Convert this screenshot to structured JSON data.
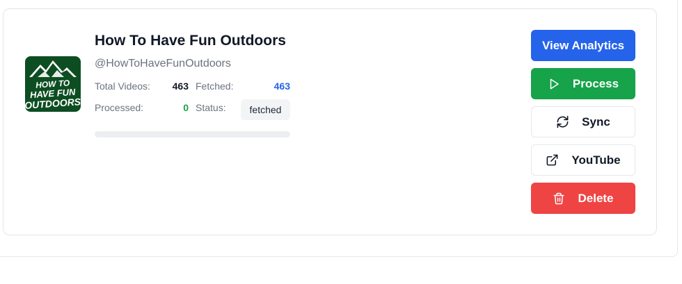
{
  "channel": {
    "title": "How To Have Fun Outdoors",
    "handle": "@HowToHaveFunOutdoors",
    "avatar_text": [
      "HOW TO",
      "HAVE FUN",
      "OUTDOORS"
    ]
  },
  "stats": {
    "total_videos_label": "Total Videos:",
    "total_videos": "463",
    "fetched_label": "Fetched:",
    "fetched": "463",
    "processed_label": "Processed:",
    "processed": "0",
    "status_label": "Status:",
    "status": "fetched",
    "progress_fraction": 0
  },
  "actions": {
    "view_analytics": "View Analytics",
    "process": "Process",
    "sync": "Sync",
    "youtube": "YouTube",
    "delete": "Delete"
  },
  "icons": {
    "process": "play-icon",
    "sync": "refresh-icon",
    "youtube": "external-link-icon",
    "delete": "trash-icon"
  },
  "colors": {
    "primary": "#2563eb",
    "success": "#16a34a",
    "danger": "#ef4444",
    "fetched_value": "#2563eb",
    "processed_value": "#16a34a"
  }
}
